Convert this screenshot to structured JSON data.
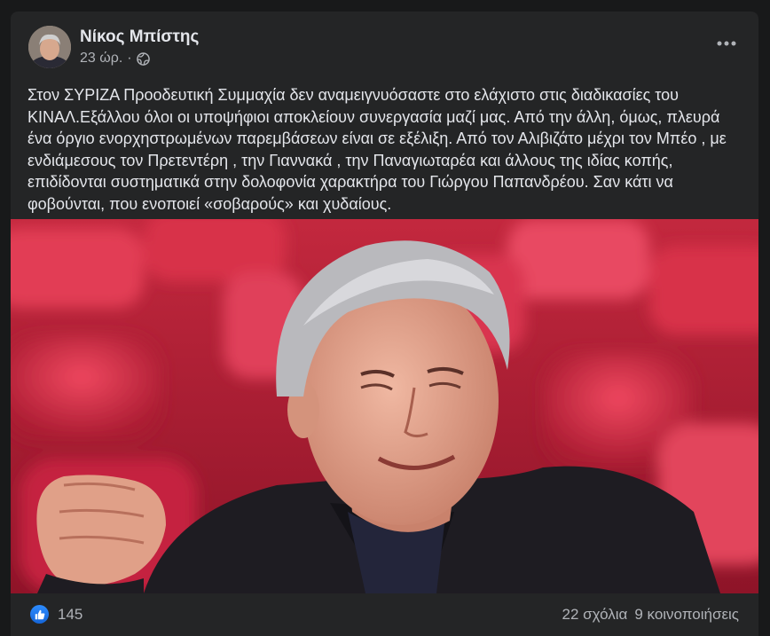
{
  "post": {
    "author": "Νίκος Μπίστης",
    "time": "23 ώρ.",
    "separator": "·",
    "privacy_icon": "globe-icon",
    "menu_icon": "more-horizontal-icon",
    "text": "Στον ΣΥΡΙΖΑ Προοδευτική Συμμαχία δεν αναμειγνυόσαστε  στο ελάχιστο στις διαδικασίες του ΚΙΝΑΛ.Εξάλλου όλοι οι υποψήφιοι αποκλείουν συνεργασία μαζί μας. Από την άλλη, όμως, πλευρά ένα όργιο ενορχηστρωμένων  παρεμβάσεων  είναι σε εξέλιξη. Από τον Αλιβιζάτο μέχρι τον Μπέο , με ενδιάμεσους τον Πρετεντέρη , την Γιαννακά , την Παναγιωταρέα και άλλους της ιδίας  κοπής, επιδίδονται συστηματικά στην δολοφονία χαρακτήρα του Γιώργου Παπανδρέου. Σαν κάτι να φοβούνται, που ενοποιεί «σοβαρούς» και χυδαίους."
  },
  "reactions": {
    "icon": "like-icon",
    "count": "145",
    "comments": "22 σχόλια",
    "shares": "9 κοινοποιήσεις"
  },
  "colors": {
    "background": "#18191a",
    "card": "#242526",
    "primary_text": "#e4e6eb",
    "secondary_text": "#b0b3b8",
    "like_blue": "#2d88ff"
  }
}
